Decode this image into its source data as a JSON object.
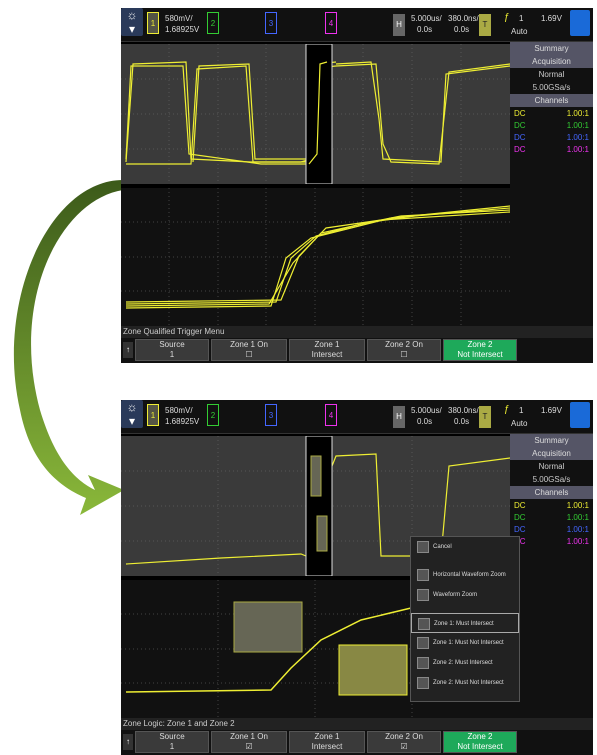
{
  "top": {
    "header": {
      "ch1_label": "1",
      "ch2_label": "2",
      "ch3_label": "3",
      "ch4_label": "4",
      "scale": "580mV/",
      "offset": "1.68925V",
      "h_label": "H",
      "time_scale": "5.000us/",
      "time_offset": "0.0s",
      "zoom_scale": "380.0ns/",
      "zoom_offset": "0.0s",
      "t_label": "T",
      "trig_source": "1",
      "trig_level": "1.69V",
      "trig_mode": "Auto"
    },
    "side": {
      "summary": "Summary",
      "acquisition": "Acquisition",
      "mode": "Normal",
      "rate": "5.00GSa/s",
      "channels": "Channels",
      "rows": [
        [
          "DC",
          "1.00:1"
        ],
        [
          "DC",
          "1.00:1"
        ],
        [
          "DC",
          "1.00:1"
        ],
        [
          "DC",
          "1.00:1"
        ]
      ]
    },
    "menu_title": "Zone Qualified Trigger Menu",
    "softkeys": [
      {
        "top": "Source",
        "bottom": "1"
      },
      {
        "top": "Zone 1 On",
        "bottom": ""
      },
      {
        "top": "Zone 1",
        "bottom": "Intersect"
      },
      {
        "top": "Zone 2 On",
        "bottom": ""
      },
      {
        "top": "Zone 2",
        "bottom": "Not Intersect"
      }
    ]
  },
  "bottom": {
    "header": {
      "ch1_label": "1",
      "ch2_label": "2",
      "ch3_label": "3",
      "ch4_label": "4",
      "scale": "580mV/",
      "offset": "1.68925V",
      "h_label": "H",
      "time_scale": "5.000us/",
      "time_offset": "0.0s",
      "zoom_scale": "380.0ns/",
      "zoom_offset": "0.0s",
      "t_label": "T",
      "trig_source": "1",
      "trig_level": "1.69V",
      "trig_mode": "Auto"
    },
    "side": {
      "summary": "Summary",
      "acquisition": "Acquisition",
      "mode": "Normal",
      "rate": "5.00GSa/s",
      "channels": "Channels",
      "rows": [
        [
          "DC",
          "1.00:1"
        ],
        [
          "DC",
          "1.00:1"
        ],
        [
          "DC",
          "1.00:1"
        ],
        [
          "DC",
          "1.00:1"
        ]
      ]
    },
    "popup": [
      "Cancel",
      "Horizontal Waveform Zoom",
      "Waveform Zoom",
      "Zone 1: Must Intersect",
      "Zone 1: Must Not Intersect",
      "Zone 2: Must Intersect",
      "Zone 2: Must Not Intersect"
    ],
    "menu_title": "Zone Logic: Zone 1 and Zone 2",
    "softkeys": [
      {
        "top": "Source",
        "bottom": "1"
      },
      {
        "top": "Zone 1 On",
        "bottom": ""
      },
      {
        "top": "Zone 1",
        "bottom": "Intersect"
      },
      {
        "top": "Zone 2 On",
        "bottom": ""
      },
      {
        "top": "Zone 2",
        "bottom": "Not Intersect"
      }
    ]
  },
  "colors": {
    "ch1": "#ee3",
    "ch2": "#3c3",
    "ch3": "#46f",
    "ch4": "#e3e",
    "accent": "#1ea95a",
    "arrow": "#5a7f1e"
  }
}
